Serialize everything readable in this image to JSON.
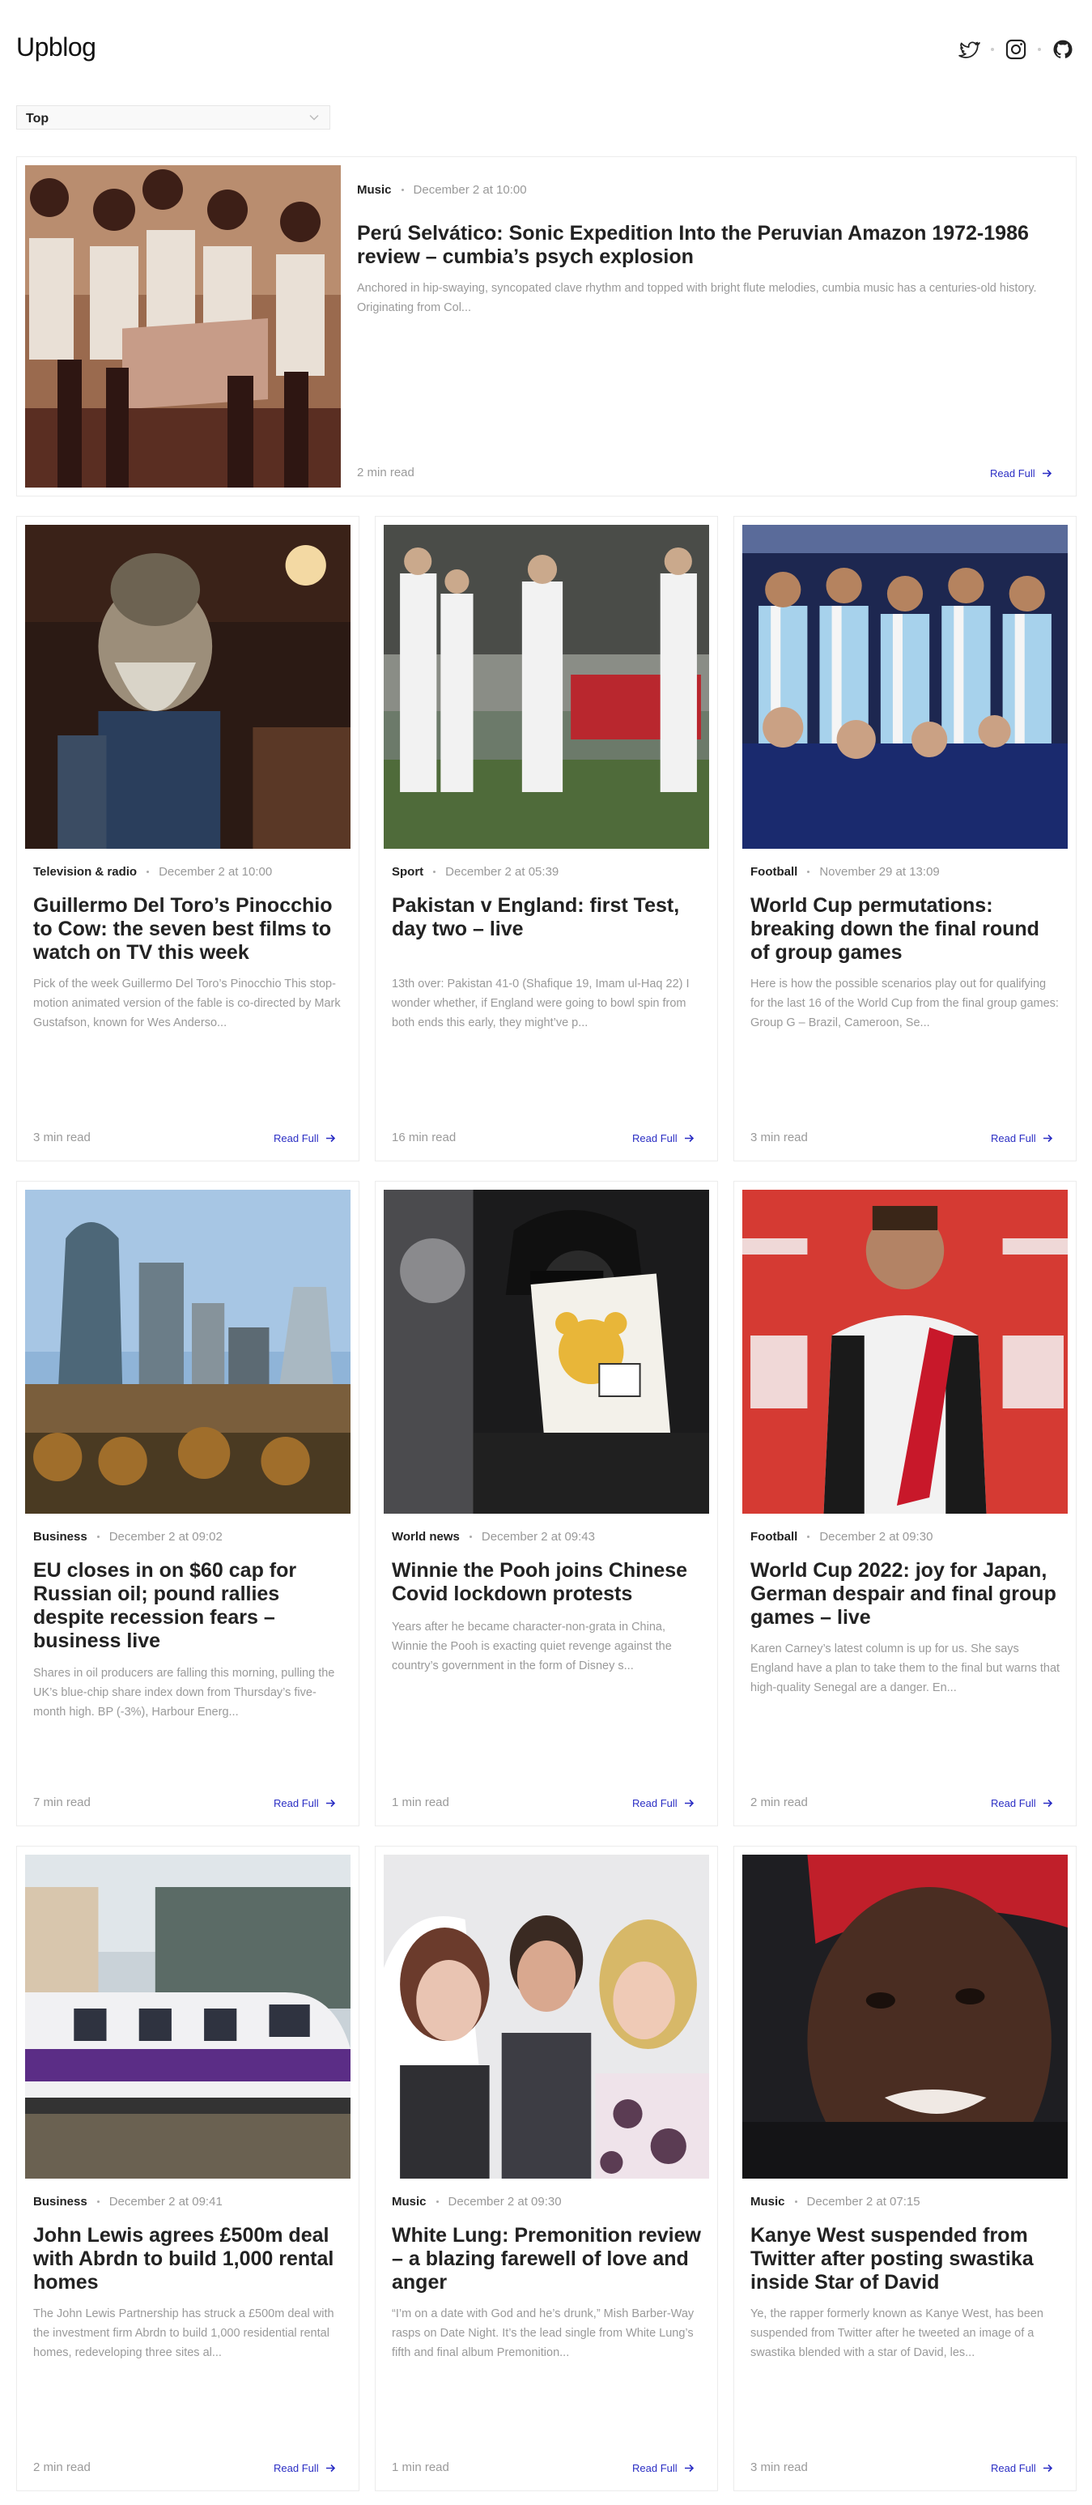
{
  "site": {
    "logo": "Upblog",
    "social": [
      {
        "icon": "twitter-icon"
      },
      {
        "icon": "instagram-icon"
      },
      {
        "icon": "github-icon"
      }
    ]
  },
  "filter": {
    "selected": "Top",
    "icon": "chevron-down-icon"
  },
  "read_full_label": "Read Full",
  "featured": {
    "category": "Music",
    "date": "December 2 at 10:00",
    "title": "Perú Selvático: Sonic Expedition Into the Peruvian Amazon 1972-1986 review – cumbia’s psych explosion",
    "excerpt": "Anchored in hip-swaying, syncopated clave rhythm and topped with bright flute melodies, cumbia music has a centuries-old history. Originating from Col...",
    "read_time": "2 min read"
  },
  "articles": [
    {
      "category": "Television & radio",
      "date": "December 2 at 10:00",
      "title": "Guillermo Del Toro’s Pinocchio to Cow: the seven best films to watch on TV this week",
      "excerpt": "Pick of the week Guillermo Del Toro’s Pinocchio This stop-motion animated version of the fable is co-directed by Mark Gustafson, known for Wes Anderso...",
      "read_time": "3 min read"
    },
    {
      "category": "Sport",
      "date": "December 2 at 05:39",
      "title": "Pakistan v England: first Test, day two – live",
      "excerpt": "13th over: Pakistan 41-0 (Shafique 19, Imam ul-Haq 22) I wonder whether, if England were going to bowl spin from both ends this early, they might’ve p...",
      "read_time": "16 min read"
    },
    {
      "category": "Football",
      "date": "November 29 at 13:09",
      "title": "World Cup permutations: breaking down the final round of group games",
      "excerpt": "Here is how the possible scenarios play out for qualifying for the last 16 of the World Cup from the final group games: Group G – Brazil, Cameroon, Se...",
      "read_time": "3 min read"
    },
    {
      "category": "Business",
      "date": "December 2 at 09:02",
      "title": "EU closes in on $60 cap for Russian oil; pound rallies despite recession fears – business live",
      "excerpt": "Shares in oil producers are falling this morning, pulling the UK’s blue-chip share index down from Thursday’s five-month high. BP (-3%), Harbour Energ...",
      "read_time": "7 min read"
    },
    {
      "category": "World news",
      "date": "December 2 at 09:43",
      "title": "Winnie the Pooh joins Chinese Covid lockdown protests",
      "excerpt": "Years after he became character-non-grata in China, Winnie the Pooh is exacting quiet revenge against the country’s government in the form of Disney s...",
      "read_time": "1 min read"
    },
    {
      "category": "Football",
      "date": "December 2 at 09:30",
      "title": "World Cup 2022: joy for Japan, German despair and final group games – live",
      "excerpt": "Karen Carney’s latest column is up for us. She says England have a plan to take them to the final but warns that high-quality Senegal are a danger. En...",
      "read_time": "2 min read"
    },
    {
      "category": "Business",
      "date": "December 2 at 09:41",
      "title": "John Lewis agrees £500m deal with Abrdn to build 1,000 rental homes",
      "excerpt": "The John Lewis Partnership has struck a £500m deal with the investment firm Abrdn to build 1,000 residential rental homes, redeveloping three sites al...",
      "read_time": "2 min read"
    },
    {
      "category": "Music",
      "date": "December 2 at 09:30",
      "title": "White Lung: Premonition review – a blazing farewell of love and anger",
      "excerpt": "“I’m on a date with God and he’s drunk,” Mish Barber-Way rasps on Date Night. It’s the lead single from White Lung’s fifth and final album Premonition...",
      "read_time": "1 min read"
    },
    {
      "category": "Music",
      "date": "December 2 at 07:15",
      "title": "Kanye West suspended from Twitter after posting swastika inside Star of David",
      "excerpt": "Ye, the rapper formerly known as Kanye West, has been suspended from Twitter after he tweeted an image of a swastika blended with a star of David, les...",
      "read_time": "3 min read"
    }
  ]
}
